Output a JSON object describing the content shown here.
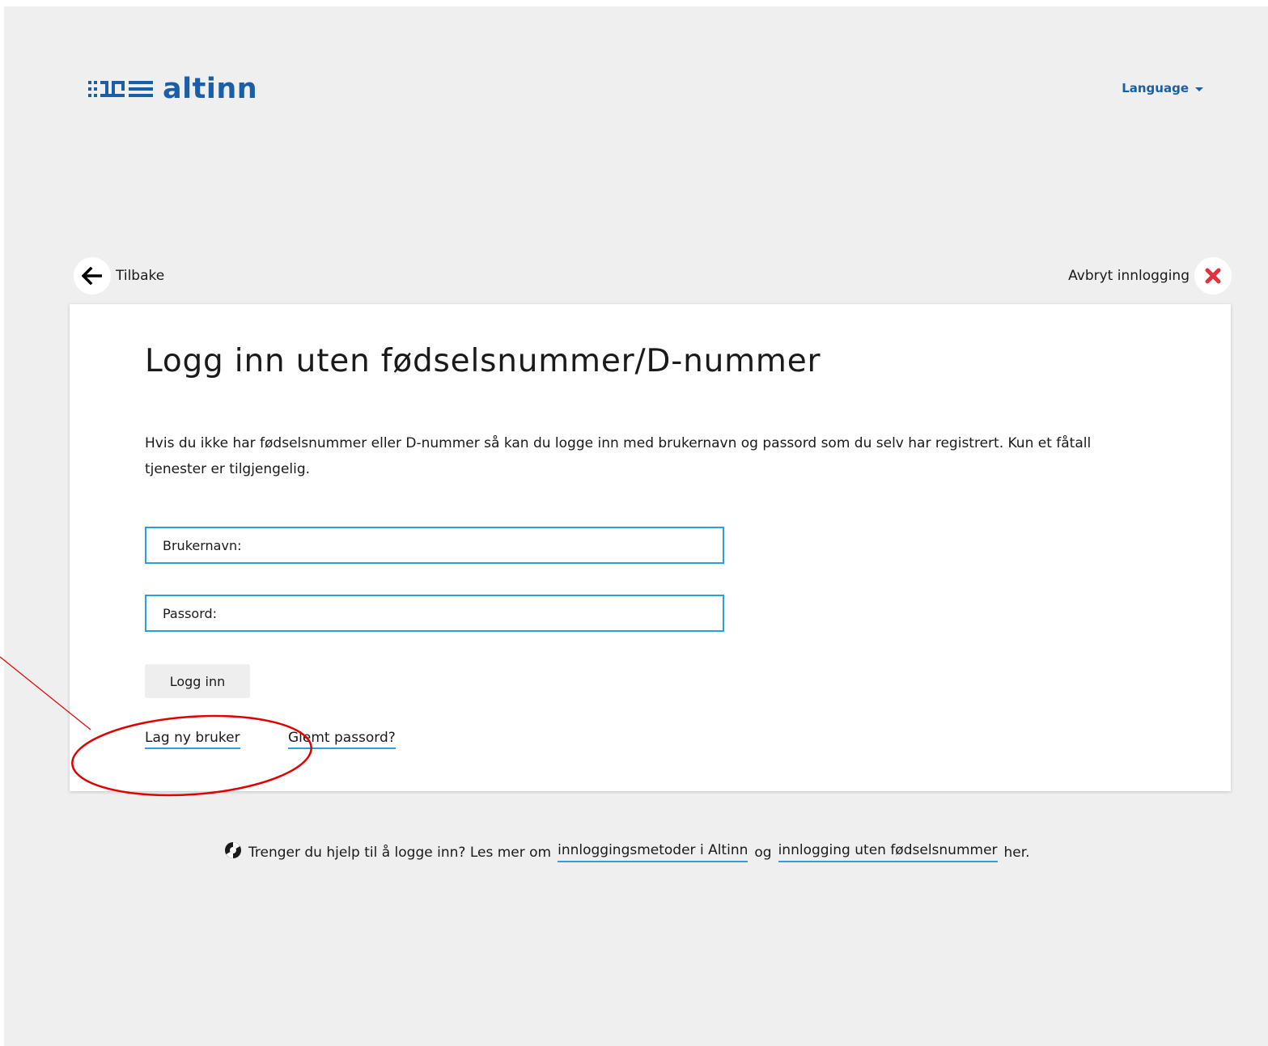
{
  "header": {
    "logo_text": "altinn",
    "language_label": "Language"
  },
  "nav": {
    "back_label": "Tilbake",
    "cancel_label": "Avbryt innlogging"
  },
  "login": {
    "title": "Logg inn uten fødselsnummer/D-nummer",
    "intro": "Hvis du ikke har fødselsnummer eller D-nummer så kan du logge inn med brukernavn og passord som du selv har registrert. Kun et fåtall tjenester er tilgjengelig.",
    "username_label": "Brukernavn:",
    "password_label": "Passord:",
    "submit_label": "Logg inn",
    "create_user_link": "Lag ny bruker",
    "forgot_password_link": "Glemt passord?"
  },
  "help": {
    "prefix": "Trenger du hjelp til å logge inn? Les mer om",
    "link1": "innloggingsmetoder i Altinn",
    "middle": "og",
    "link2": "innlogging uten fødselsnummer",
    "suffix": "her."
  },
  "colors": {
    "brand_blue": "#1b5ea8",
    "accent_cyan": "#2aa1d9",
    "cancel_red": "#e0323f",
    "annotation_red": "#e00000",
    "page_bg": "#efefef"
  },
  "icons": {
    "logo": "altinn-logo-icon",
    "back": "arrow-left-icon",
    "cancel": "close-icon",
    "help": "lifebuoy-icon",
    "language": "caret-down-icon"
  }
}
